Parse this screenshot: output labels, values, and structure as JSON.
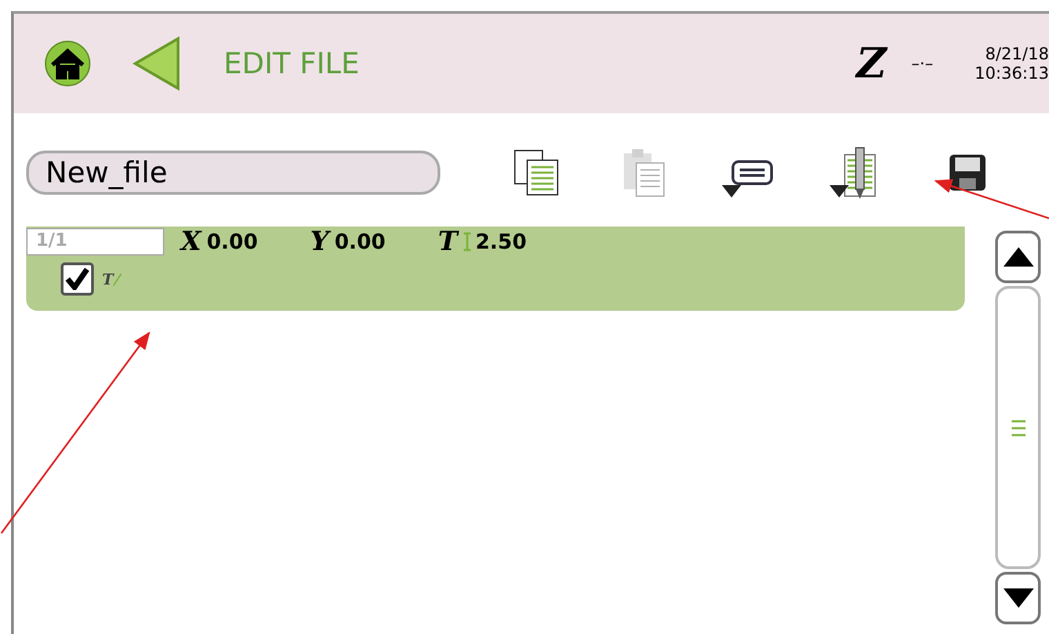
{
  "header": {
    "title": "EDIT FILE",
    "axis": "Z",
    "status": "–·–",
    "date": "8/21/18",
    "time": "10:36:13"
  },
  "file_name": {
    "value": "New_file"
  },
  "toolbar": [
    {
      "kind": "copy",
      "disabled": false,
      "has_menu": false
    },
    {
      "kind": "paste",
      "disabled": true,
      "has_menu": false
    },
    {
      "kind": "comment",
      "disabled": false,
      "has_menu": true
    },
    {
      "kind": "tool",
      "disabled": false,
      "has_menu": true
    },
    {
      "kind": "save",
      "disabled": false,
      "has_menu": false
    }
  ],
  "rows": [
    {
      "index": "1/1",
      "selected": true,
      "checked": true,
      "option_label": "T",
      "fields": [
        {
          "kind": "axis",
          "label": "X",
          "value": "0.00"
        },
        {
          "kind": "axis",
          "label": "Y",
          "value": "0.00"
        },
        {
          "kind": "tool",
          "label": "T",
          "value": "2.50"
        }
      ]
    }
  ]
}
